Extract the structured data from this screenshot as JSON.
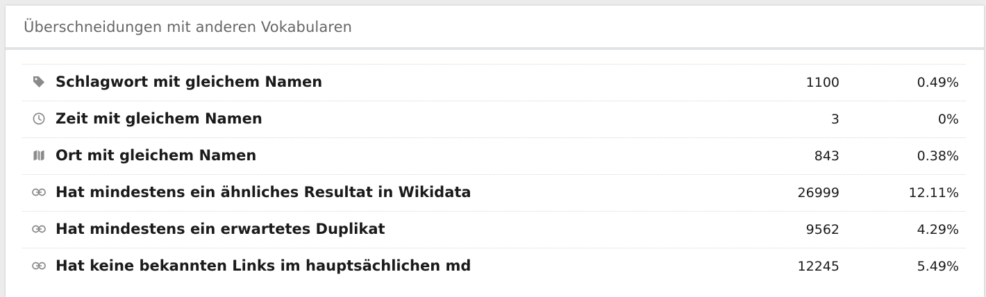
{
  "panel": {
    "title": "Überschneidungen mit anderen Vokabularen"
  },
  "colors": {
    "icon": "#8a8a8a",
    "header_border": "#e1e4e6",
    "text": "#1a1a1a",
    "title": "#666666"
  },
  "rows": [
    {
      "icon": "tag-icon",
      "label": "Schlagwort mit gleichem Namen",
      "count": "1100",
      "percent": "0.49%"
    },
    {
      "icon": "clock-icon",
      "label": "Zeit mit gleichem Namen",
      "count": "3",
      "percent": "0%"
    },
    {
      "icon": "map-icon",
      "label": "Ort mit gleichem Namen",
      "count": "843",
      "percent": "0.38%"
    },
    {
      "icon": "link-icon",
      "label": "Hat mindestens ein ähnliches Resultat in Wikidata",
      "count": "26999",
      "percent": "12.11%"
    },
    {
      "icon": "link-icon",
      "label": "Hat mindestens ein erwartetes Duplikat",
      "count": "9562",
      "percent": "4.29%"
    },
    {
      "icon": "link-icon",
      "label": "Hat keine bekannten Links im hauptsächlichen md",
      "count": "12245",
      "percent": "5.49%"
    }
  ]
}
